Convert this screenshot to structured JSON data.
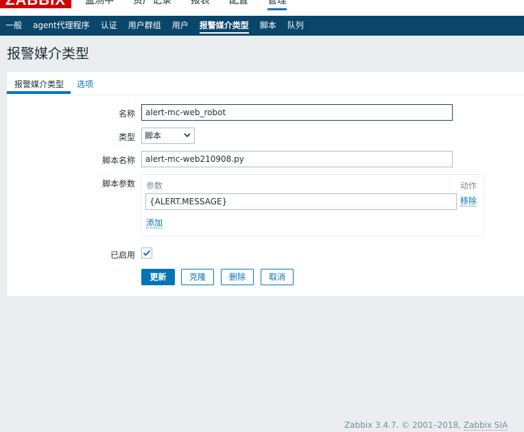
{
  "brand": {
    "logo_text": "ZABBIX",
    "logo_color": "#d40000"
  },
  "top_menu": [
    {
      "label": "监测中"
    },
    {
      "label": "资产记录"
    },
    {
      "label": "报表"
    },
    {
      "label": "配置"
    },
    {
      "label": "管理",
      "active": true
    }
  ],
  "sub_menu": [
    {
      "label": "一般"
    },
    {
      "label": "agent代理程序"
    },
    {
      "label": "认证"
    },
    {
      "label": "用户群组"
    },
    {
      "label": "用户"
    },
    {
      "label": "报警媒介类型",
      "active": true
    },
    {
      "label": "脚本"
    },
    {
      "label": "队列"
    }
  ],
  "page": {
    "title": "报警媒介类型"
  },
  "tabs": [
    {
      "label": "报警媒介类型",
      "active": true
    },
    {
      "label": "选项"
    }
  ],
  "form": {
    "name_label": "名称",
    "name_value": "alert-mc-web_robot",
    "type_label": "类型",
    "type_value": "脚本",
    "script_name_label": "脚本名称",
    "script_name_value": "alert-mc-web210908.py",
    "script_params_label": "脚本参数",
    "params_header": "参数",
    "params_action_header": "动作",
    "params": [
      {
        "value": "{ALERT.MESSAGE}",
        "remove_label": "移除"
      }
    ],
    "add_label": "添加",
    "enabled_label": "已启用",
    "enabled": true
  },
  "buttons": {
    "update": "更新",
    "clone": "克隆",
    "delete": "删除",
    "cancel": "取消"
  },
  "footer": {
    "text": "Zabbix 3.4.7. © 2001–2018, ",
    "link": "Zabbix SIA"
  },
  "colors": {
    "accent": "#0275b8",
    "nav_bg": "#0a466a",
    "page_bg": "#ebeef0"
  }
}
